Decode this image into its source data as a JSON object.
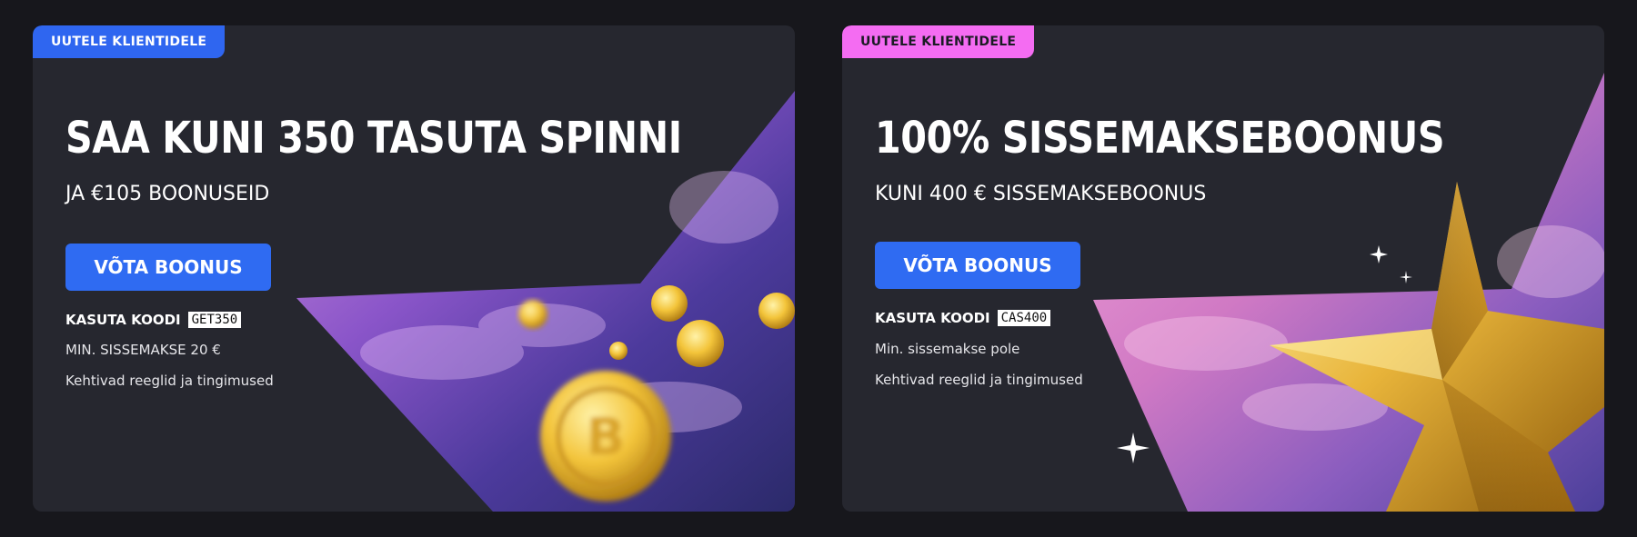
{
  "offers": [
    {
      "badge": "UUTELE KLIENTIDELE",
      "title": "SAA KUNI 350 TASUTA SPINNI",
      "subtitle": "JA €105 BOONUSEID",
      "cta": "VÕTA BOONUS",
      "code_label": "KASUTA KOODI",
      "code": "GET350",
      "min_deposit": "MIN. SISSEMAKSE 20 €",
      "terms": "Kehtivad reeglid ja tingimused",
      "badge_color": "#2f66f0"
    },
    {
      "badge": "UUTELE KLIENTIDELE",
      "title": "100% SISSEMAKSEBOONUS",
      "subtitle": "KUNI 400 € SISSEMAKSEBOONUS",
      "cta": "VÕTA BOONUS",
      "code_label": "KASUTA KOODI",
      "code": "CAS400",
      "min_deposit": "Min. sissemakse pole",
      "terms": "Kehtivad reeglid ja tingimused",
      "badge_color": "#f46cf2"
    }
  ],
  "colors": {
    "background": "#17171c",
    "card": "#26272f",
    "button": "#2f6bf2"
  }
}
